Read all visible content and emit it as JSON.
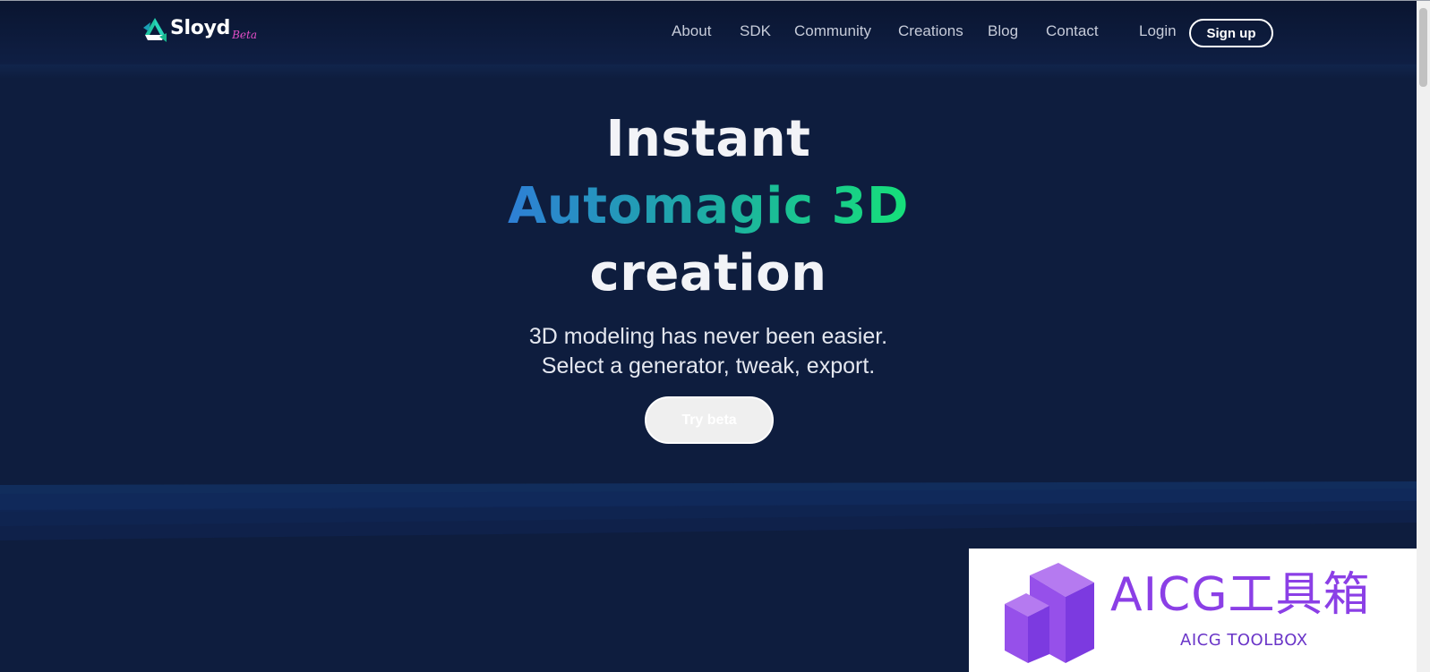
{
  "brand": {
    "name": "Sloyd",
    "tag": "Beta",
    "logo_icon": "sloyd-triangle-logo",
    "colors": {
      "accent_teal": "#1fc6a2",
      "tag_pink": "#e24ec7"
    }
  },
  "nav": {
    "links": [
      "About",
      "SDK",
      "Community",
      "Creations",
      "Blog",
      "Contact"
    ],
    "login": "Login",
    "signup": "Sign up"
  },
  "hero": {
    "line1": "Instant",
    "line2": "Automagic 3D",
    "line3": "creation",
    "sub1": "3D modeling has never been easier.",
    "sub2": "Select a generator, tweak, export.",
    "cta": "Try beta",
    "gradient_colors": [
      "#2e7fd6",
      "#16e07a"
    ]
  },
  "watermark": {
    "title": "AICG工具箱",
    "subtitle": "AICG TOOLBOX",
    "icon": "aicg-cube-logo",
    "color": "#8b3fe6"
  },
  "background_color": "#0e1d3e"
}
